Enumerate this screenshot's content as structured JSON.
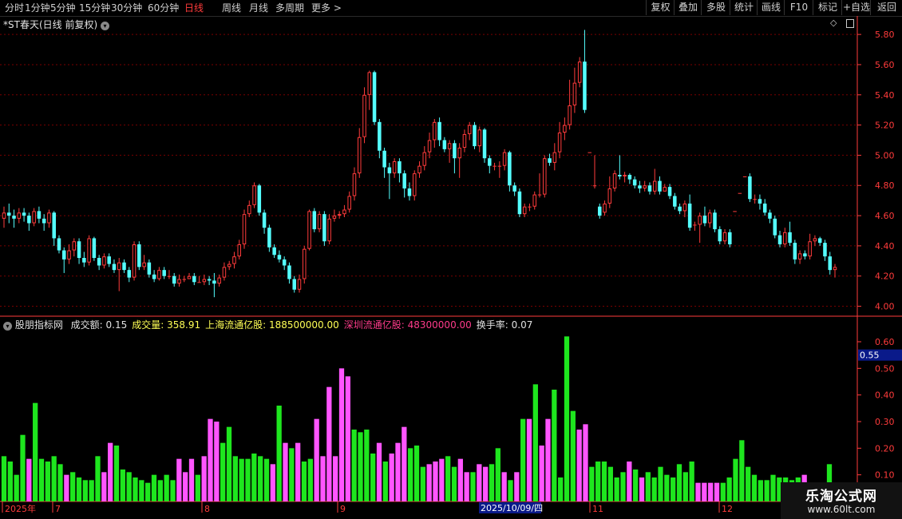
{
  "toolbar": {
    "periods": [
      "分时",
      "1分钟",
      "5分钟",
      "15分钟",
      "30分钟",
      "60分钟",
      "日线",
      "周线",
      "月线",
      "多周期",
      "更多 >"
    ],
    "active_period": "日线",
    "right_buttons": [
      "复权",
      "叠加",
      "多股",
      "统计",
      "画线",
      "F10",
      "标记",
      "+自选",
      "返回"
    ]
  },
  "main_chart": {
    "title": "*ST春天(日线 前复权)",
    "price_axis": [
      "5.80",
      "5.60",
      "5.40",
      "5.20",
      "5.00",
      "4.80",
      "4.60",
      "4.40",
      "4.20",
      "4.00"
    ]
  },
  "indicator": {
    "name": "股朋指标网",
    "fields": [
      {
        "label": "成交额:",
        "value": "0.15",
        "color": "#e0e0e0"
      },
      {
        "label": "成交量:",
        "value": "358.91",
        "color": "#ffff55"
      },
      {
        "label": "上海流通亿股:",
        "value": "188500000.00",
        "color": "#ffff55"
      },
      {
        "label": "深圳流通亿股:",
        "value": "48300000.00",
        "color": "#ff3b8b"
      },
      {
        "label": "换手率:",
        "value": "0.07",
        "color": "#e0e0e0"
      }
    ],
    "axis": [
      "0.60",
      "0.50",
      "0.40",
      "0.30",
      "0.20",
      "0.10"
    ],
    "current_value": "0.55"
  },
  "x_axis": {
    "labels": [
      "2025年",
      "7",
      "8",
      "9",
      "10",
      "11",
      "12"
    ],
    "cursor_date": "2025/10/09/四"
  },
  "watermark": {
    "title": "乐淘公式网",
    "url": "www.60lt.com"
  },
  "colors": {
    "up": "#ff3b3b",
    "down": "#54ffff",
    "bar_up": "#ff55ff",
    "bar_down": "#1ee61e",
    "axis": "#ff3b3b",
    "grid": "#7a0000"
  },
  "chart_data": {
    "type": "candlestick",
    "y_range": [
      3.95,
      5.88
    ],
    "candles": [
      [
        4.58,
        4.62,
        4.66,
        4.52
      ],
      [
        4.62,
        4.6,
        4.68,
        4.55
      ],
      [
        4.6,
        4.58,
        4.64,
        4.52
      ],
      [
        4.58,
        4.62,
        4.65,
        4.55
      ],
      [
        4.62,
        4.6,
        4.65,
        4.56
      ],
      [
        4.6,
        4.55,
        4.62,
        4.5
      ],
      [
        4.55,
        4.63,
        4.65,
        4.53
      ],
      [
        4.63,
        4.58,
        4.66,
        4.55
      ],
      [
        4.58,
        4.55,
        4.61,
        4.5
      ],
      [
        4.55,
        4.62,
        4.64,
        4.52
      ],
      [
        4.62,
        4.45,
        4.63,
        4.4
      ],
      [
        4.45,
        4.37,
        4.47,
        4.35
      ],
      [
        4.37,
        4.31,
        4.39,
        4.22
      ],
      [
        4.31,
        4.37,
        4.41,
        4.28
      ],
      [
        4.37,
        4.43,
        4.45,
        4.33
      ],
      [
        4.43,
        4.32,
        4.45,
        4.28
      ],
      [
        4.32,
        4.29,
        4.36,
        4.26
      ],
      [
        4.29,
        4.45,
        4.47,
        4.27
      ],
      [
        4.45,
        4.32,
        4.46,
        4.3
      ],
      [
        4.32,
        4.27,
        4.34,
        4.24
      ],
      [
        4.27,
        4.33,
        4.35,
        4.25
      ],
      [
        4.33,
        4.28,
        4.35,
        4.26
      ],
      [
        4.28,
        4.24,
        4.31,
        4.22
      ],
      [
        4.24,
        4.29,
        4.32,
        4.1
      ],
      [
        4.29,
        4.24,
        4.31,
        4.22
      ],
      [
        4.24,
        4.19,
        4.26,
        4.16
      ],
      [
        4.19,
        4.41,
        4.43,
        4.17
      ],
      [
        4.41,
        4.26,
        4.43,
        4.24
      ],
      [
        4.26,
        4.29,
        4.34,
        4.24
      ],
      [
        4.29,
        4.21,
        4.31,
        4.19
      ],
      [
        4.21,
        4.18,
        4.24,
        4.16
      ],
      [
        4.18,
        4.24,
        4.26,
        4.17
      ],
      [
        4.24,
        4.2,
        4.26,
        4.18
      ],
      [
        4.2,
        4.2,
        4.24,
        4.18
      ],
      [
        4.2,
        4.15,
        4.22,
        4.13
      ],
      [
        4.15,
        4.18,
        4.21,
        4.13
      ],
      [
        4.18,
        4.18,
        4.2,
        4.16
      ],
      [
        4.18,
        4.2,
        4.22,
        4.18
      ],
      [
        4.2,
        4.16,
        4.22,
        4.14
      ],
      [
        4.16,
        4.16,
        4.2,
        4.16
      ],
      [
        4.16,
        4.18,
        4.21,
        4.14
      ],
      [
        4.18,
        4.17,
        4.2,
        4.14
      ],
      [
        4.17,
        4.15,
        4.22,
        4.06
      ],
      [
        4.15,
        4.19,
        4.21,
        4.13
      ],
      [
        4.19,
        4.26,
        4.29,
        4.17
      ],
      [
        4.26,
        4.28,
        4.3,
        4.24
      ],
      [
        4.28,
        4.33,
        4.36,
        4.25
      ],
      [
        4.33,
        4.41,
        4.44,
        4.31
      ],
      [
        4.41,
        4.61,
        4.64,
        4.38
      ],
      [
        4.61,
        4.67,
        4.7,
        4.59
      ],
      [
        4.67,
        4.8,
        4.82,
        4.65
      ],
      [
        4.8,
        4.62,
        4.81,
        4.6
      ],
      [
        4.62,
        4.52,
        4.64,
        4.48
      ],
      [
        4.52,
        4.39,
        4.54,
        4.36
      ],
      [
        4.39,
        4.34,
        4.41,
        4.32
      ],
      [
        4.34,
        4.31,
        4.37,
        4.29
      ],
      [
        4.31,
        4.27,
        4.33,
        4.24
      ],
      [
        4.27,
        4.18,
        4.29,
        4.15
      ],
      [
        4.18,
        4.11,
        4.2,
        4.09
      ],
      [
        4.11,
        4.18,
        4.21,
        4.09
      ],
      [
        4.18,
        4.38,
        4.4,
        4.15
      ],
      [
        4.38,
        4.63,
        4.64,
        4.37
      ],
      [
        4.63,
        4.51,
        4.65,
        4.49
      ],
      [
        4.51,
        4.61,
        4.63,
        4.49
      ],
      [
        4.61,
        4.43,
        4.63,
        4.4
      ],
      [
        4.43,
        4.58,
        4.61,
        4.41
      ],
      [
        4.58,
        4.6,
        4.64,
        4.56
      ],
      [
        4.6,
        4.61,
        4.63,
        4.58
      ],
      [
        4.61,
        4.64,
        4.67,
        4.59
      ],
      [
        4.64,
        4.73,
        4.76,
        4.62
      ],
      [
        4.73,
        4.88,
        4.92,
        4.7
      ],
      [
        4.88,
        5.12,
        5.18,
        4.85
      ],
      [
        5.12,
        5.4,
        5.45,
        5.08
      ],
      [
        5.4,
        5.55,
        5.56,
        5.3
      ],
      [
        5.55,
        5.22,
        5.56,
        5.2
      ],
      [
        5.22,
        5.03,
        5.24,
        4.98
      ],
      [
        5.03,
        4.92,
        5.05,
        4.85
      ],
      [
        4.92,
        4.88,
        4.95,
        4.71
      ],
      [
        4.88,
        4.96,
        4.98,
        4.85
      ],
      [
        4.96,
        4.88,
        4.98,
        4.82
      ],
      [
        4.88,
        4.78,
        4.9,
        4.72
      ],
      [
        4.78,
        4.73,
        4.82,
        4.7
      ],
      [
        4.73,
        4.88,
        4.9,
        4.7
      ],
      [
        4.88,
        4.93,
        4.96,
        4.85
      ],
      [
        4.93,
        5.02,
        5.06,
        4.9
      ],
      [
        5.02,
        5.1,
        5.15,
        4.98
      ],
      [
        5.1,
        5.22,
        5.24,
        5.05
      ],
      [
        5.22,
        5.1,
        5.25,
        5.06
      ],
      [
        5.1,
        5.04,
        5.12,
        5.02
      ],
      [
        5.04,
        5.08,
        5.1,
        4.95
      ],
      [
        5.08,
        4.98,
        5.1,
        4.88
      ],
      [
        4.98,
        5.05,
        5.08,
        4.85
      ],
      [
        5.05,
        5.14,
        5.17,
        5.02
      ],
      [
        5.14,
        5.2,
        5.22,
        5.1
      ],
      [
        5.2,
        5.06,
        5.22,
        5.04
      ],
      [
        5.06,
        5.17,
        5.19,
        5.02
      ],
      [
        5.17,
        4.98,
        5.18,
        4.95
      ],
      [
        4.98,
        4.93,
        5.0,
        4.88
      ],
      [
        4.93,
        4.93,
        4.95,
        4.9
      ],
      [
        4.93,
        4.93,
        4.96,
        4.85
      ],
      [
        4.93,
        5.02,
        5.04,
        4.9
      ],
      [
        5.02,
        4.8,
        5.03,
        4.76
      ],
      [
        4.8,
        4.76,
        4.82,
        4.73
      ],
      [
        4.76,
        4.61,
        4.78,
        4.59
      ],
      [
        4.61,
        4.66,
        4.68,
        4.59
      ],
      [
        4.66,
        4.66,
        4.68,
        4.63
      ],
      [
        4.66,
        4.74,
        4.76,
        4.64
      ],
      [
        4.74,
        4.74,
        4.88,
        4.72
      ],
      [
        4.74,
        4.98,
        5.0,
        4.72
      ],
      [
        4.98,
        4.95,
        5.01,
        4.93
      ],
      [
        4.95,
        5.02,
        5.08,
        4.9
      ],
      [
        5.02,
        5.15,
        5.22,
        4.98
      ],
      [
        5.15,
        5.2,
        5.25,
        5.1
      ],
      [
        5.2,
        5.33,
        5.5,
        5.17
      ],
      [
        5.33,
        5.48,
        5.58,
        5.28
      ],
      [
        5.48,
        5.62,
        5.65,
        5.45
      ],
      [
        5.62,
        5.3,
        5.83,
        5.28
      ],
      [
        5.02,
        5.02,
        5.02,
        5.02
      ],
      [
        4.8,
        4.8,
        5.0,
        4.78
      ],
      [
        4.66,
        4.6,
        4.68,
        4.58
      ],
      [
        4.62,
        4.68,
        4.7,
        4.6
      ],
      [
        4.68,
        4.78,
        4.86,
        4.65
      ],
      [
        4.78,
        4.88,
        4.9,
        4.76
      ],
      [
        4.87,
        4.86,
        5.0,
        4.84
      ],
      [
        4.86,
        4.87,
        4.89,
        4.82
      ],
      [
        4.87,
        4.84,
        4.88,
        4.81
      ],
      [
        4.84,
        4.8,
        4.86,
        4.78
      ],
      [
        4.8,
        4.78,
        4.83,
        4.75
      ],
      [
        4.78,
        4.8,
        4.83,
        4.76
      ],
      [
        4.8,
        4.76,
        4.82,
        4.74
      ],
      [
        4.76,
        4.83,
        4.91,
        4.74
      ],
      [
        4.83,
        4.76,
        4.86,
        4.74
      ],
      [
        4.76,
        4.79,
        4.81,
        4.76
      ],
      [
        4.79,
        4.73,
        4.81,
        4.71
      ],
      [
        4.73,
        4.66,
        4.75,
        4.64
      ],
      [
        4.66,
        4.63,
        4.68,
        4.61
      ],
      [
        4.63,
        4.68,
        4.7,
        4.59
      ],
      [
        4.68,
        4.52,
        4.74,
        4.5
      ],
      [
        4.54,
        4.54,
        4.56,
        4.5
      ],
      [
        4.54,
        4.6,
        4.62,
        4.42
      ],
      [
        4.6,
        4.55,
        4.66,
        4.53
      ],
      [
        4.55,
        4.62,
        4.64,
        4.52
      ],
      [
        4.62,
        4.51,
        4.64,
        4.49
      ],
      [
        4.51,
        4.43,
        4.53,
        4.41
      ],
      [
        4.43,
        4.49,
        4.51,
        4.41
      ],
      [
        4.49,
        4.41,
        4.51,
        4.39
      ],
      [
        4.63,
        4.63,
        4.63,
        4.63
      ],
      [
        4.75,
        4.75,
        4.75,
        4.75
      ],
      [
        4.86,
        4.86,
        4.86,
        4.86
      ],
      [
        4.86,
        4.71,
        4.88,
        4.69
      ],
      [
        4.71,
        4.71,
        4.74,
        4.68
      ],
      [
        4.71,
        4.68,
        4.74,
        4.64
      ],
      [
        4.68,
        4.62,
        4.71,
        4.6
      ],
      [
        4.62,
        4.58,
        4.64,
        4.55
      ],
      [
        4.58,
        4.47,
        4.6,
        4.45
      ],
      [
        4.47,
        4.41,
        4.5,
        4.39
      ],
      [
        4.41,
        4.49,
        4.52,
        4.39
      ],
      [
        4.49,
        4.42,
        4.56,
        4.4
      ],
      [
        4.42,
        4.31,
        4.44,
        4.28
      ],
      [
        4.31,
        4.35,
        4.37,
        4.28
      ],
      [
        4.35,
        4.33,
        4.37,
        4.31
      ],
      [
        4.33,
        4.43,
        4.48,
        4.31
      ],
      [
        4.43,
        4.45,
        4.47,
        4.4
      ],
      [
        4.45,
        4.42,
        4.46,
        4.4
      ],
      [
        4.42,
        4.33,
        4.44,
        4.3
      ],
      [
        4.33,
        4.24,
        4.36,
        4.21
      ],
      [
        4.24,
        4.26,
        4.28,
        4.19
      ]
    ],
    "volume": [
      [
        0.17,
        0
      ],
      [
        0.15,
        0
      ],
      [
        0.1,
        0
      ],
      [
        0.25,
        0
      ],
      [
        0.16,
        1
      ],
      [
        0.37,
        0
      ],
      [
        0.16,
        0
      ],
      [
        0.15,
        0
      ],
      [
        0.17,
        0
      ],
      [
        0.14,
        0
      ],
      [
        0.1,
        1
      ],
      [
        0.11,
        0
      ],
      [
        0.09,
        0
      ],
      [
        0.08,
        0
      ],
      [
        0.08,
        0
      ],
      [
        0.17,
        0
      ],
      [
        0.11,
        1
      ],
      [
        0.22,
        1
      ],
      [
        0.21,
        0
      ],
      [
        0.12,
        0
      ],
      [
        0.11,
        0
      ],
      [
        0.09,
        0
      ],
      [
        0.08,
        0
      ],
      [
        0.07,
        0
      ],
      [
        0.1,
        0
      ],
      [
        0.08,
        0
      ],
      [
        0.1,
        0
      ],
      [
        0.08,
        0
      ],
      [
        0.16,
        1
      ],
      [
        0.11,
        1
      ],
      [
        0.16,
        1
      ],
      [
        0.1,
        0
      ],
      [
        0.17,
        1
      ],
      [
        0.31,
        1
      ],
      [
        0.3,
        1
      ],
      [
        0.22,
        0
      ],
      [
        0.28,
        0
      ],
      [
        0.17,
        0
      ],
      [
        0.16,
        0
      ],
      [
        0.16,
        0
      ],
      [
        0.18,
        0
      ],
      [
        0.17,
        0
      ],
      [
        0.16,
        0
      ],
      [
        0.14,
        1
      ],
      [
        0.36,
        0
      ],
      [
        0.22,
        1
      ],
      [
        0.2,
        0
      ],
      [
        0.22,
        1
      ],
      [
        0.15,
        0
      ],
      [
        0.16,
        0
      ],
      [
        0.31,
        1
      ],
      [
        0.17,
        1
      ],
      [
        0.43,
        1
      ],
      [
        0.17,
        1
      ],
      [
        0.5,
        1
      ],
      [
        0.47,
        1
      ],
      [
        0.27,
        0
      ],
      [
        0.26,
        0
      ],
      [
        0.27,
        0
      ],
      [
        0.18,
        0
      ],
      [
        0.22,
        1
      ],
      [
        0.15,
        0
      ],
      [
        0.18,
        1
      ],
      [
        0.22,
        1
      ],
      [
        0.28,
        1
      ],
      [
        0.2,
        0
      ],
      [
        0.21,
        0
      ],
      [
        0.13,
        0
      ],
      [
        0.14,
        1
      ],
      [
        0.15,
        1
      ],
      [
        0.16,
        1
      ],
      [
        0.17,
        0
      ],
      [
        0.13,
        0
      ],
      [
        0.16,
        1
      ],
      [
        0.11,
        1
      ],
      [
        0.11,
        0
      ],
      [
        0.14,
        1
      ],
      [
        0.13,
        1
      ],
      [
        0.14,
        0
      ],
      [
        0.2,
        0
      ],
      [
        0.11,
        1
      ],
      [
        0.08,
        0
      ],
      [
        0.11,
        1
      ],
      [
        0.31,
        0
      ],
      [
        0.31,
        1
      ],
      [
        0.44,
        0
      ],
      [
        0.21,
        1
      ],
      [
        0.31,
        1
      ],
      [
        0.42,
        0
      ],
      [
        0.09,
        0
      ],
      [
        0.62,
        0
      ],
      [
        0.34,
        0
      ],
      [
        0.27,
        1
      ],
      [
        0.29,
        1
      ],
      [
        0.13,
        0
      ],
      [
        0.15,
        0
      ],
      [
        0.15,
        0
      ],
      [
        0.13,
        0
      ],
      [
        0.09,
        0
      ],
      [
        0.11,
        0
      ],
      [
        0.15,
        1
      ],
      [
        0.12,
        0
      ],
      [
        0.09,
        1
      ],
      [
        0.11,
        0
      ],
      [
        0.09,
        0
      ],
      [
        0.13,
        0
      ],
      [
        0.1,
        0
      ],
      [
        0.09,
        0
      ],
      [
        0.14,
        0
      ],
      [
        0.11,
        0
      ],
      [
        0.15,
        0
      ],
      [
        0.07,
        1
      ],
      [
        0.07,
        1
      ],
      [
        0.07,
        1
      ],
      [
        0.07,
        1
      ],
      [
        0.07,
        0
      ],
      [
        0.09,
        0
      ],
      [
        0.16,
        0
      ],
      [
        0.23,
        0
      ],
      [
        0.13,
        0
      ],
      [
        0.1,
        0
      ],
      [
        0.08,
        0
      ],
      [
        0.08,
        0
      ],
      [
        0.1,
        0
      ],
      [
        0.09,
        0
      ],
      [
        0.09,
        0
      ],
      [
        0.08,
        0
      ],
      [
        0.09,
        0
      ],
      [
        0.1,
        1
      ],
      [
        0.07,
        0
      ],
      [
        0.07,
        0
      ],
      [
        0.06,
        0
      ],
      [
        0.14,
        0
      ]
    ]
  }
}
